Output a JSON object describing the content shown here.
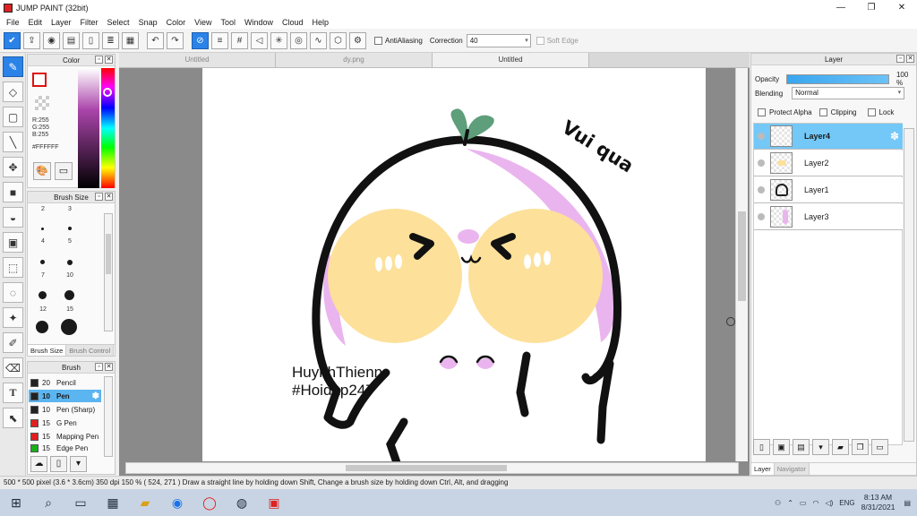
{
  "window": {
    "title": "JUMP PAINT (32bit)",
    "minimize_glyph": "—",
    "restore_glyph": "❐",
    "close_glyph": "✕"
  },
  "menu": [
    "File",
    "Edit",
    "Layer",
    "Filter",
    "Select",
    "Snap",
    "Color",
    "View",
    "Tool",
    "Window",
    "Cloud",
    "Help"
  ],
  "toolbar": {
    "antialiasing_label": "AntiAliasing",
    "correction_label": "Correction",
    "correction_value": "40",
    "soft_edge_label": "Soft Edge"
  },
  "color_panel": {
    "title": "Color",
    "r": "R:255",
    "g": "G:255",
    "b": "B:255",
    "hex": "#FFFFFF"
  },
  "brush_size_panel": {
    "title": "Brush Size",
    "sizes": [
      "2",
      "3",
      "4",
      "5",
      "8",
      "9",
      "7",
      "10",
      "12",
      "15"
    ],
    "tab_active": "Brush Size",
    "tab_inactive": "Brush Control"
  },
  "brush_panel": {
    "title": "Brush",
    "items": [
      {
        "size": "20",
        "name": "Pencil",
        "color": "#222222"
      },
      {
        "size": "10",
        "name": "Pen",
        "color": "#222222"
      },
      {
        "size": "10",
        "name": "Pen (Sharp)",
        "color": "#222222"
      },
      {
        "size": "15",
        "name": "G Pen",
        "color": "#e02020"
      },
      {
        "size": "15",
        "name": "Mapping Pen",
        "color": "#e02020"
      },
      {
        "size": "15",
        "name": "Edge Pen",
        "color": "#19b019"
      }
    ]
  },
  "documents": {
    "tabs": [
      "Untitled",
      "dy.png",
      "Untitled"
    ]
  },
  "artwork": {
    "caption_line1": "HuynhThienn",
    "caption_line2": "#Hoidap247",
    "speech": "Vui qua"
  },
  "layer_panel": {
    "title": "Layer",
    "opacity_label": "Opacity",
    "opacity_value": "100 %",
    "opacity_fraction": 1.0,
    "blending_label": "Blending",
    "blending_value": "Normal",
    "protect_alpha_label": "Protect Alpha",
    "clipping_label": "Clipping",
    "lock_label": "Lock",
    "layers": [
      "Layer4",
      "Layer2",
      "Layer1",
      "Layer3"
    ],
    "tab_layer": "Layer",
    "tab_navigator": "Navigator"
  },
  "status_bar": {
    "text": "500 * 500 pixel   (3.6 * 3.6cm)   350 dpi   150 %   ( 524, 271 )   Draw a straight line by holding down Shift, Change a brush size by holding down Ctrl, Alt, and dragging"
  },
  "taskbar": {
    "language": "ENG",
    "time": "8:13 AM",
    "date": "8/31/2021"
  },
  "colors": {
    "accent": "#2b83e8",
    "layer_selected": "#73c8f7",
    "brush_selected": "#5bb5f0",
    "blush_yellow": "#fde09a",
    "pink": "#eab5ee",
    "leaf_green": "#5e9e7a"
  }
}
